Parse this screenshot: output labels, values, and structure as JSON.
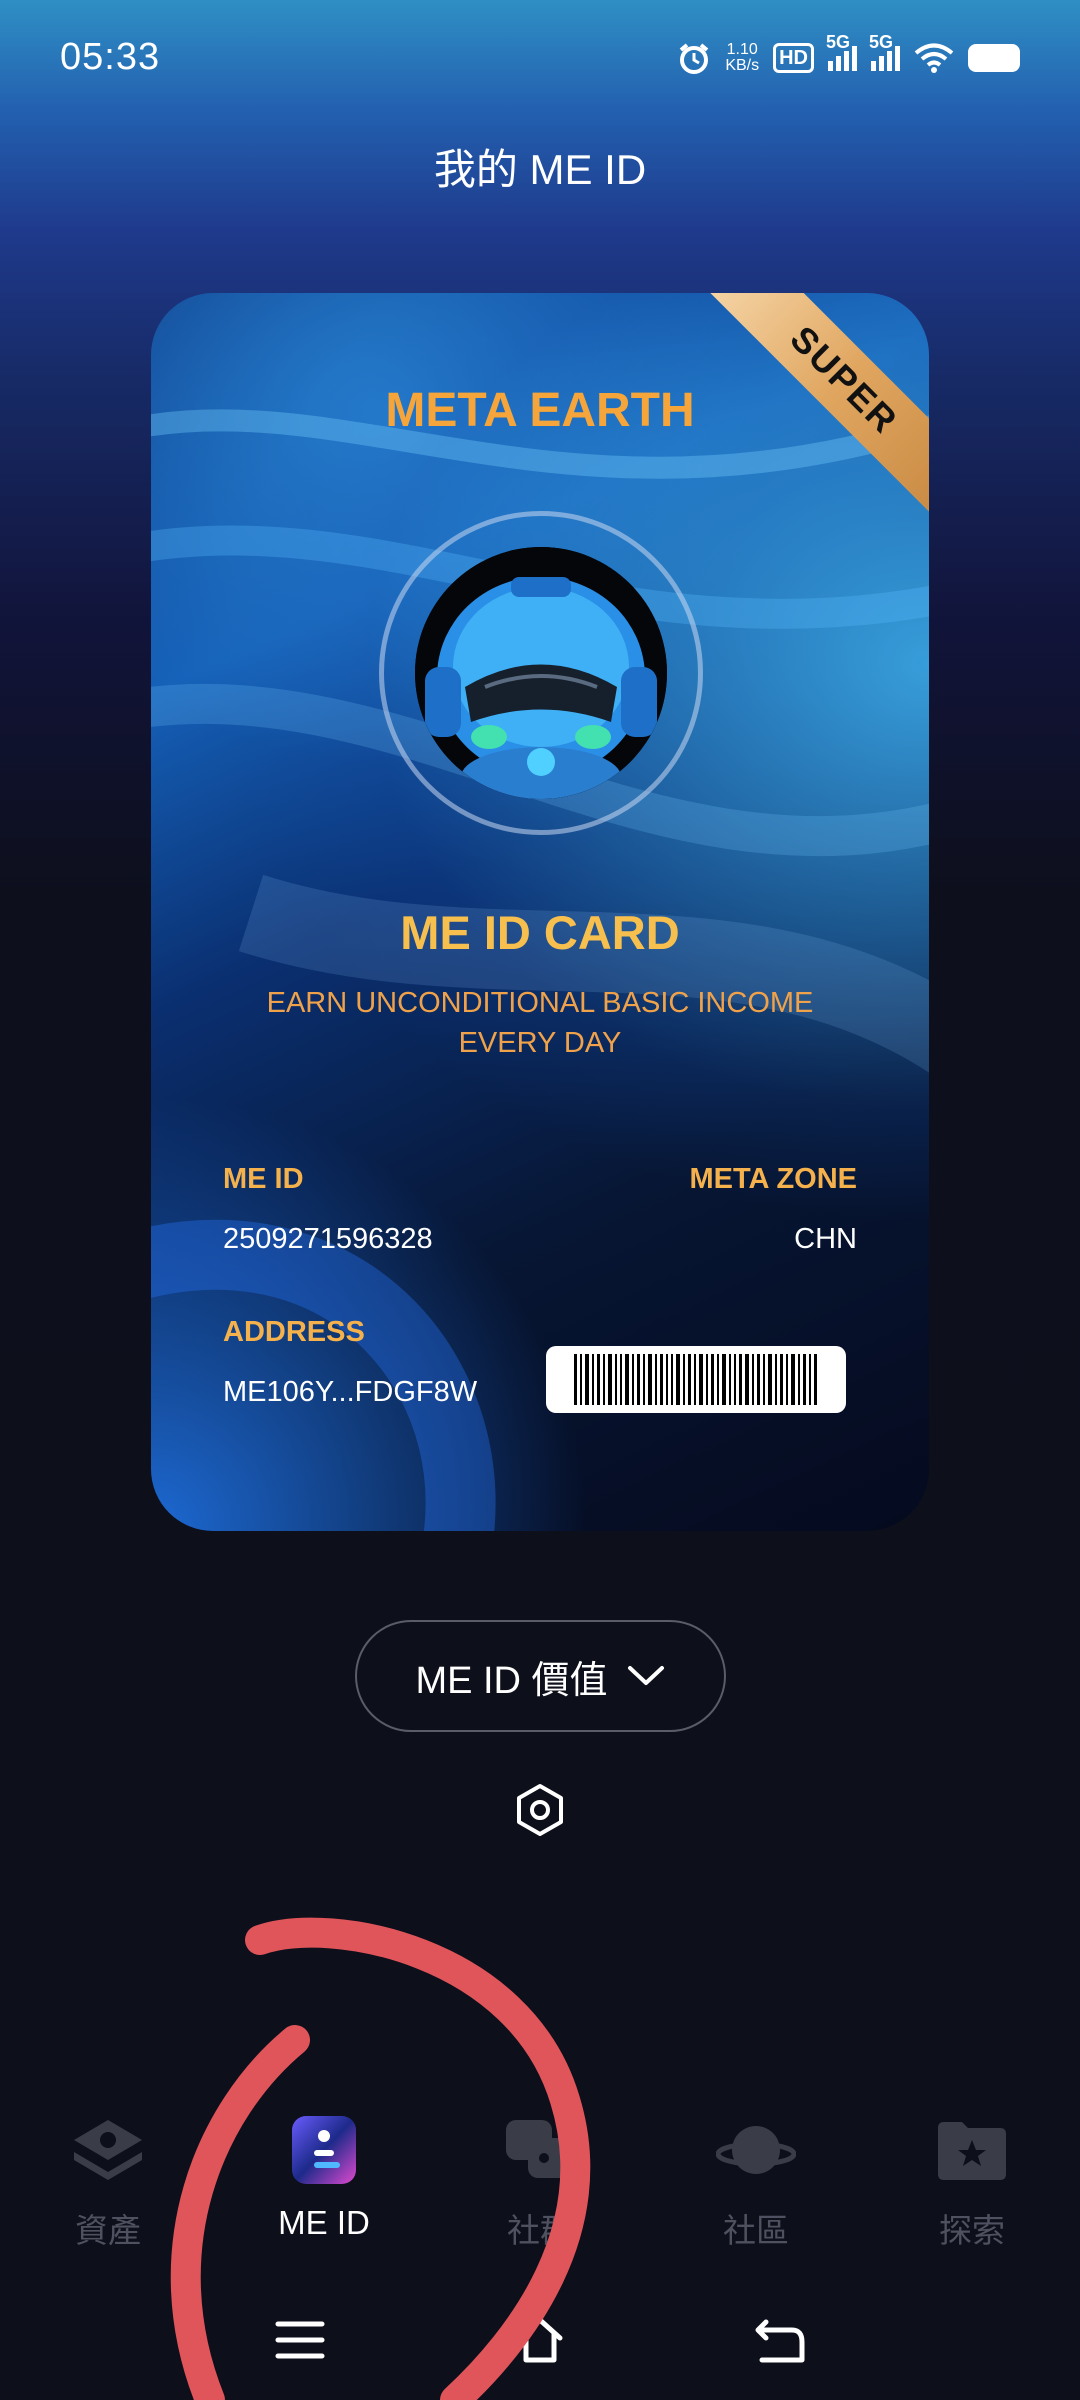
{
  "status_bar": {
    "time": "05:33",
    "net_speed_value": "1.10",
    "net_speed_unit": "KB/s",
    "hd_label": "HD",
    "signal1": "5G",
    "signal2": "5G"
  },
  "header": {
    "title": "我的 ME ID"
  },
  "card": {
    "ribbon": "SUPER",
    "brand": "META EARTH",
    "title": "ME ID CARD",
    "subtitle_line1": "EARN UNCONDITIONAL BASIC INCOME",
    "subtitle_line2": "EVERY DAY",
    "me_id_label": "ME ID",
    "me_id_value": "2509271596328",
    "meta_zone_label": "META ZONE",
    "meta_zone_value": "CHN",
    "address_label": "ADDRESS",
    "address_value": "ME106Y...FDGF8W"
  },
  "value_dropdown": {
    "label": "ME ID 價值"
  },
  "bottom_nav": {
    "items": [
      {
        "label": "資產",
        "icon": "assets-icon",
        "active": false
      },
      {
        "label": "ME ID",
        "icon": "me-id-icon",
        "active": true
      },
      {
        "label": "社群",
        "icon": "social-icon",
        "active": false
      },
      {
        "label": "社區",
        "icon": "community-planet-icon",
        "active": false
      },
      {
        "label": "探索",
        "icon": "explore-folder-icon",
        "active": false
      }
    ]
  },
  "colors": {
    "accent_gold": "#f5b14b",
    "brand_orange": "#f5a53a",
    "annotation_red": "#e0555a",
    "background": "#0d0f1a"
  }
}
